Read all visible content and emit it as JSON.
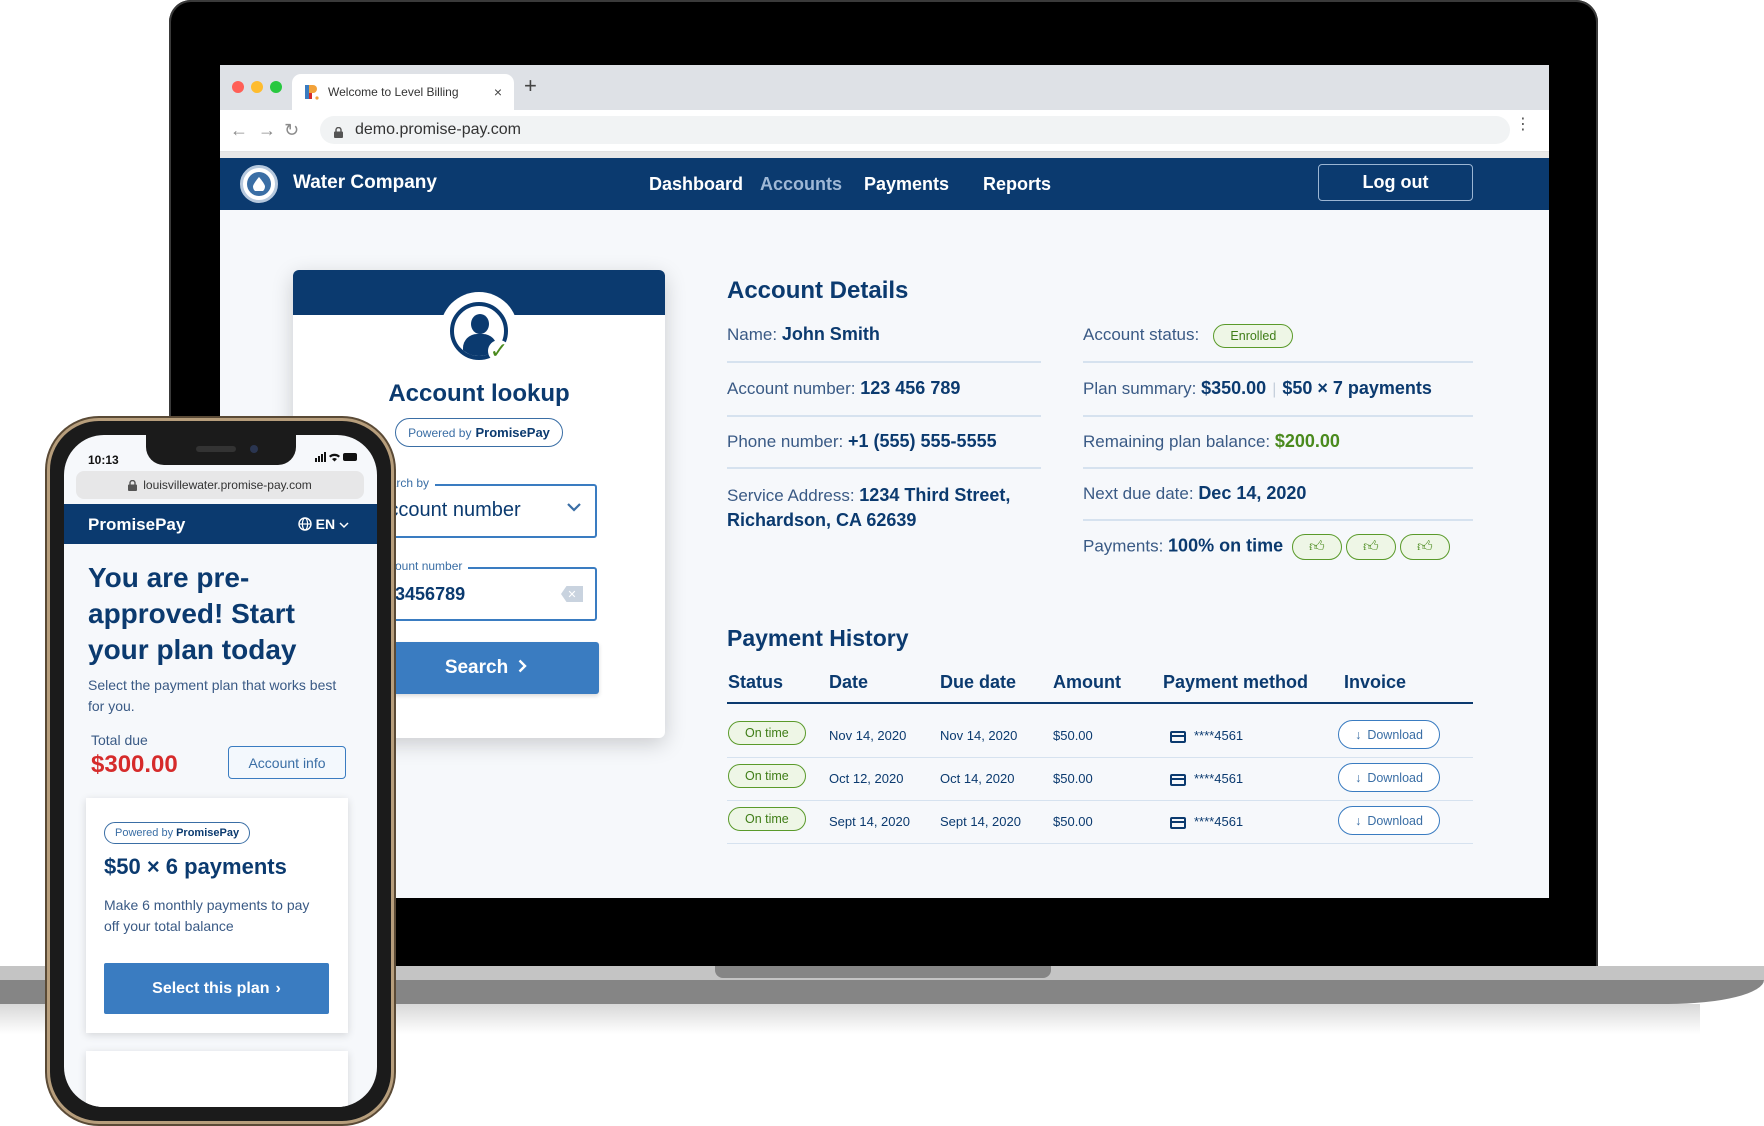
{
  "browser": {
    "tab_title": "Welcome to Level Billing",
    "tab_close": "×",
    "new_tab": "+",
    "url": "demo.promise-pay.com",
    "back_icon": "←",
    "forward_icon": "→",
    "reload_icon": "↻",
    "menu_icon": "⋮",
    "traffic_lights": [
      "#ff5f57",
      "#febc2e",
      "#28c840"
    ]
  },
  "app": {
    "brand": "Water Company",
    "logo_glyph": "💧",
    "nav": [
      {
        "label": "Dashboard",
        "active": false
      },
      {
        "label": "Accounts",
        "active": true
      },
      {
        "label": "Payments",
        "active": false
      },
      {
        "label": "Reports",
        "active": false
      }
    ],
    "logout_label": "Log out"
  },
  "lookup": {
    "title": "Account lookup",
    "powered_prefix": "Powered by",
    "powered_brand": "PromisePay",
    "search_by_label": "Search by",
    "search_by_value": "Account number",
    "account_label": "Account number",
    "account_value": "123456789",
    "search_button": "Search",
    "chevron": "›"
  },
  "details": {
    "title": "Account Details",
    "name_label": "Name:",
    "name_value": "John Smith",
    "account_label": "Account number:",
    "account_value": "123 456 789",
    "phone_label": "Phone number:",
    "phone_value": "+1 (555) 555-5555",
    "address_label": "Service Address:",
    "address_line1": "1234 Third Street,",
    "address_line2": "Richardson, CA 62639",
    "status_label": "Account status:",
    "status_value": "Enrolled",
    "plan_label": "Plan summary:",
    "plan_total": "$350.00",
    "plan_sep": "|",
    "plan_terms": "$50 × 7 payments",
    "remaining_label": "Remaining plan balance:",
    "remaining_value": "$200.00",
    "next_due_label": "Next due date:",
    "next_due_value": "Dec 14, 2020",
    "payments_label": "Payments:",
    "payments_value": "100% on time",
    "on_time_thumbs": 3,
    "thumb_icon": "👍"
  },
  "history": {
    "title": "Payment History",
    "columns": [
      "Status",
      "Date",
      "Due date",
      "Amount",
      "Payment method",
      "Invoice"
    ],
    "rows": [
      {
        "status": "On time",
        "date": "Nov 14, 2020",
        "due": "Nov 14, 2020",
        "amount": "$50.00",
        "method": "****4561",
        "invoice": "Download"
      },
      {
        "status": "On time",
        "date": "Oct 12, 2020",
        "due": "Oct 14, 2020",
        "amount": "$50.00",
        "method": "****4561",
        "invoice": "Download"
      },
      {
        "status": "On time",
        "date": "Sept 14, 2020",
        "due": "Sept 14, 2020",
        "amount": "$50.00",
        "method": "****4561",
        "invoice": "Download"
      }
    ],
    "download_icon": "↓"
  },
  "phone": {
    "time": "10:13",
    "status_icons": "▂▄▆ ᯤ ▬",
    "url": "louisvillewater.promise-pay.com",
    "brand": "PromisePay",
    "lang": "EN",
    "lang_chevron": "⌄",
    "globe_icon": "🌐",
    "hero": "You are pre-approved! Start your plan today",
    "sub": "Select the payment plan that works best for you.",
    "total_label": "Total due",
    "total_value": "$300.00",
    "account_info": "Account info",
    "plan": {
      "powered_prefix": "Powered by",
      "powered_brand": "PromisePay",
      "title": "$50 × 6 payments",
      "desc": "Make 6 monthly payments to pay off your total balance",
      "button": "Select this plan",
      "chevron": "›"
    }
  },
  "colors": {
    "navy": "#0b3a6f",
    "accent_blue": "#3a7cc1",
    "success_green": "#4a8a1d",
    "alert_red": "#d62b2b"
  }
}
